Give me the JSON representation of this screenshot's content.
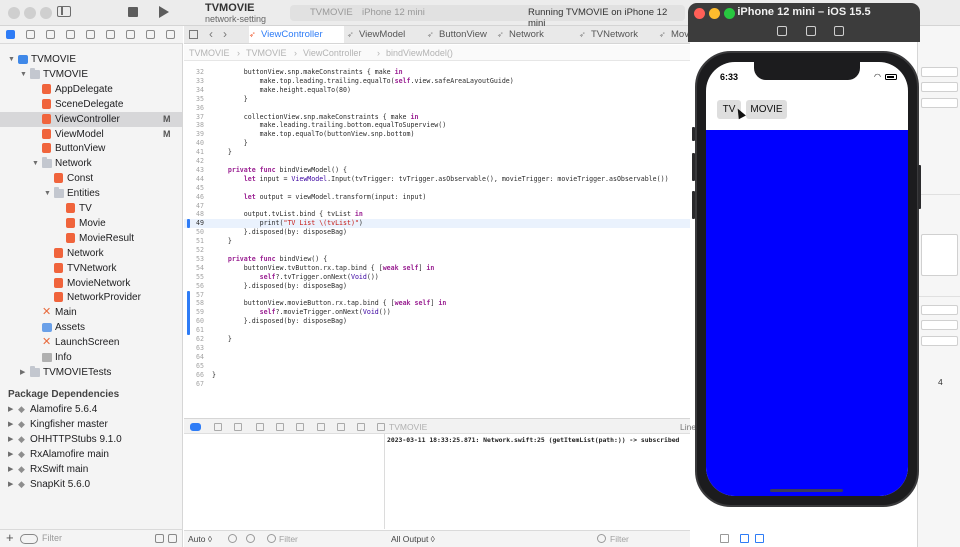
{
  "titlebar": {
    "project_name": "TVMOVIE",
    "branch": "network-setting",
    "scheme": "TVMOVIE",
    "device": "iPhone 12 mini",
    "run_status": "Running TVMOVIE on iPhone 12 mini"
  },
  "tabs": [
    {
      "label": "ViewController",
      "active": true
    },
    {
      "label": "ViewModel",
      "active": false
    },
    {
      "label": "ButtonView",
      "active": false
    },
    {
      "label": "Network",
      "active": false
    },
    {
      "label": "TVNetwork",
      "active": false
    },
    {
      "label": "Movi",
      "active": false
    }
  ],
  "jumpbar": [
    "TVMOVIE",
    "TVMOVIE",
    "ViewController",
    "bindViewModel()"
  ],
  "navigator": {
    "tree": [
      {
        "label": "TVMOVIE",
        "icon": "project-icon",
        "indent": 0,
        "disclosure": "open"
      },
      {
        "label": "TVMOVIE",
        "icon": "folder-icon",
        "indent": 1,
        "disclosure": "open"
      },
      {
        "label": "AppDelegate",
        "icon": "swift-file-icon",
        "indent": 2
      },
      {
        "label": "SceneDelegate",
        "icon": "swift-file-icon",
        "indent": 2
      },
      {
        "label": "ViewController",
        "icon": "swift-file-icon",
        "indent": 2,
        "badge": "M",
        "selected": true
      },
      {
        "label": "ViewModel",
        "icon": "swift-file-icon",
        "indent": 2,
        "badge": "M"
      },
      {
        "label": "ButtonView",
        "icon": "swift-file-icon",
        "indent": 2
      },
      {
        "label": "Network",
        "icon": "folder-icon",
        "indent": 2,
        "disclosure": "open"
      },
      {
        "label": "Const",
        "icon": "swift-file-icon",
        "indent": 3
      },
      {
        "label": "Entities",
        "icon": "folder-icon",
        "indent": 3,
        "disclosure": "open"
      },
      {
        "label": "TV",
        "icon": "swift-file-icon",
        "indent": 4
      },
      {
        "label": "Movie",
        "icon": "swift-file-icon",
        "indent": 4
      },
      {
        "label": "MovieResult",
        "icon": "swift-file-icon",
        "indent": 4
      },
      {
        "label": "Network",
        "icon": "swift-file-icon",
        "indent": 3
      },
      {
        "label": "TVNetwork",
        "icon": "swift-file-icon",
        "indent": 3
      },
      {
        "label": "MovieNetwork",
        "icon": "swift-file-icon",
        "indent": 3
      },
      {
        "label": "NetworkProvider",
        "icon": "swift-file-icon",
        "indent": 3
      },
      {
        "label": "Main",
        "icon": "storyboard-icon",
        "indent": 2
      },
      {
        "label": "Assets",
        "icon": "assets-icon",
        "indent": 2
      },
      {
        "label": "LaunchScreen",
        "icon": "storyboard-icon",
        "indent": 2
      },
      {
        "label": "Info",
        "icon": "plist-icon",
        "indent": 2
      },
      {
        "label": "TVMOVIETests",
        "icon": "folder-icon",
        "indent": 1,
        "disclosure": "closed"
      }
    ],
    "packages_header": "Package Dependencies",
    "packages": [
      {
        "label": "Alamofire 5.6.4",
        "icon": "package-icon"
      },
      {
        "label": "Kingfisher master",
        "icon": "package-icon"
      },
      {
        "label": "OHHTTPStubs 9.1.0",
        "icon": "package-icon"
      },
      {
        "label": "RxAlamofire main",
        "icon": "package-icon"
      },
      {
        "label": "RxSwift main",
        "icon": "package-icon"
      },
      {
        "label": "SnapKit 5.6.0",
        "icon": "package-icon"
      }
    ],
    "filter_placeholder": "Filter"
  },
  "code": {
    "current_line": 49,
    "change_ranges": [
      [
        49,
        49
      ],
      [
        57,
        61
      ]
    ],
    "lines": [
      {
        "n": 32,
        "t": "        buttonView.snp.makeConstraints { make in"
      },
      {
        "n": 33,
        "t": "            make.top.leading.trailing.equalTo(self.view.safeAreaLayoutGuide)"
      },
      {
        "n": 34,
        "t": "            make.height.equalTo(80)"
      },
      {
        "n": 35,
        "t": "        }"
      },
      {
        "n": 36,
        "t": ""
      },
      {
        "n": 37,
        "t": "        collectionView.snp.makeConstraints { make in"
      },
      {
        "n": 38,
        "t": "            make.leading.trailing.bottom.equalToSuperview()"
      },
      {
        "n": 39,
        "t": "            make.top.equalTo(buttonView.snp.bottom)"
      },
      {
        "n": 40,
        "t": "        }"
      },
      {
        "n": 41,
        "t": "    }"
      },
      {
        "n": 42,
        "t": ""
      },
      {
        "n": 43,
        "t": "    private func bindViewModel() {"
      },
      {
        "n": 44,
        "t": "        let input = ViewModel.Input(tvTrigger: tvTrigger.asObservable(), movieTrigger: movieTrigger.asObservable())"
      },
      {
        "n": 45,
        "t": ""
      },
      {
        "n": 46,
        "t": "        let output = viewModel.transform(input: input)"
      },
      {
        "n": 47,
        "t": ""
      },
      {
        "n": 48,
        "t": "        output.tvList.bind { tvList in"
      },
      {
        "n": 49,
        "t": "            print(\"TV List \\(tvList)\")"
      },
      {
        "n": 50,
        "t": "        }.disposed(by: disposeBag)"
      },
      {
        "n": 51,
        "t": "    }"
      },
      {
        "n": 52,
        "t": ""
      },
      {
        "n": 53,
        "t": "    private func bindView() {"
      },
      {
        "n": 54,
        "t": "        buttonView.tvButton.rx.tap.bind { [weak self] in"
      },
      {
        "n": 55,
        "t": "            self?.tvTrigger.onNext(Void())"
      },
      {
        "n": 56,
        "t": "        }.disposed(by: disposeBag)"
      },
      {
        "n": 57,
        "t": ""
      },
      {
        "n": 58,
        "t": "        buttonView.movieButton.rx.tap.bind { [weak self] in"
      },
      {
        "n": 59,
        "t": "            self?.movieTrigger.onNext(Void())"
      },
      {
        "n": 60,
        "t": "        }.disposed(by: disposeBag)"
      },
      {
        "n": 61,
        "t": ""
      },
      {
        "n": 62,
        "t": "    }"
      },
      {
        "n": 63,
        "t": ""
      },
      {
        "n": 64,
        "t": ""
      },
      {
        "n": 65,
        "t": ""
      },
      {
        "n": 66,
        "t": "}"
      },
      {
        "n": 67,
        "t": ""
      }
    ]
  },
  "debug": {
    "target": "TVMOVIE",
    "line_label": "Line",
    "console_output": "2023-03-11 18:33:25.871: Network.swift:25 (getItemList(path:)) -> subscribed",
    "variables_scope": "Auto ◊",
    "output_scope": "All Output ◊",
    "variables_filter_placeholder": "Filter",
    "console_filter_placeholder": "Filter"
  },
  "inspector": {
    "stepper_value": "4"
  },
  "simulator": {
    "title": "iPhone 12 mini – iOS 15.5",
    "status_time": "6:33",
    "tv_button_label": "TV",
    "movie_button_label": "MOVIE",
    "collection_background": "#0000ff"
  },
  "colors": {
    "accent": "#2e7cf6",
    "swift_icon": "#f0643c",
    "keyword": "#9b2393",
    "string": "#c41a16"
  }
}
